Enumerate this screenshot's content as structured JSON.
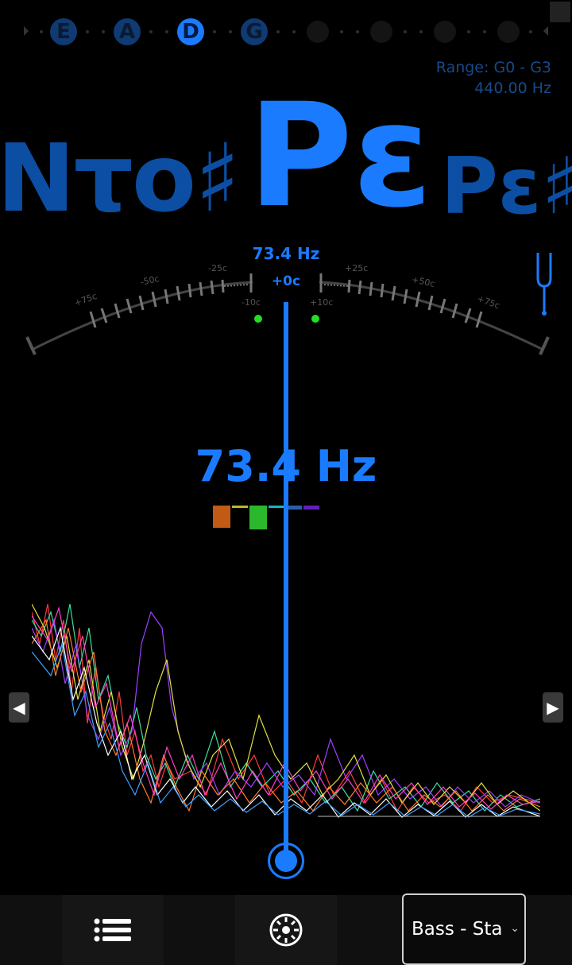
{
  "strings": {
    "items": [
      {
        "label": "E",
        "state": "dim"
      },
      {
        "label": "A",
        "state": "dim"
      },
      {
        "label": "D",
        "state": "active"
      },
      {
        "label": "G",
        "state": "dim"
      },
      {
        "label": "",
        "state": "empty"
      },
      {
        "label": "",
        "state": "empty"
      },
      {
        "label": "",
        "state": "empty"
      },
      {
        "label": "",
        "state": "empty"
      }
    ]
  },
  "range": {
    "text": "Range: G0 - G3",
    "reference": "440.00 Hz"
  },
  "notes": {
    "left_text": "Ντο♯",
    "center_text": "Ρε",
    "right_text": "Ρε♯"
  },
  "gauge": {
    "freq_small": "73.4 Hz",
    "cents": "+0c",
    "tick_labels": [
      "+75c",
      "-50c",
      "-25c",
      "-10c",
      "+10c",
      "+25c",
      "+50c",
      "+75c"
    ]
  },
  "readout": {
    "frequency": "73.4 Hz"
  },
  "colors": {
    "accent": "#1a7bff",
    "dim_accent": "#0c4ea3",
    "harmonic_bars": [
      "#c05a14",
      "#b0c020",
      "#2cb82c",
      "#20b0c0",
      "#2860b0",
      "#6020c0"
    ]
  },
  "icons": {
    "tuning_fork": "tuning-fork-icon",
    "menu": "list-menu-icon",
    "settings": "dial-settings-icon",
    "prev": "arrow-left-icon",
    "next": "arrow-right-icon"
  },
  "toolbar": {
    "tuning_value": "Bass - Sta",
    "prev_arrow": "◀",
    "next_arrow": "▶",
    "chevron": "⌄"
  }
}
